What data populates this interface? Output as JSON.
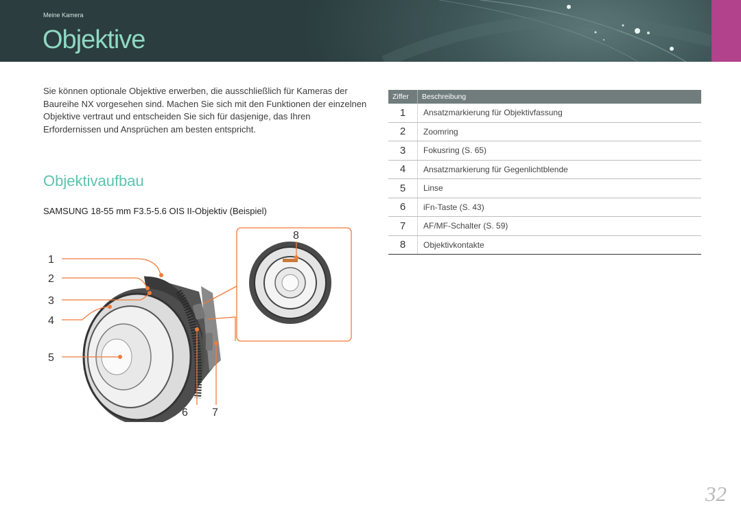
{
  "header": {
    "breadcrumb": "Meine Kamera",
    "title": "Objektive",
    "accent_color": "#b2428c"
  },
  "intro": "Sie können optionale Objektive erwerben, die ausschließlich für Kameras der Baureihe NX vorgesehen sind. Machen Sie sich mit den Funktionen der einzelnen Objektive vertraut und entscheiden Sie sich für dasjenige, das Ihren Erfordernissen und Ansprüchen am besten entspricht.",
  "section": {
    "title": "Objektivaufbau",
    "subtitle": "SAMSUNG 18-55 mm F3.5-5.6 OIS II-Objektiv (Beispiel)"
  },
  "figure": {
    "callouts": [
      "1",
      "2",
      "3",
      "4",
      "5",
      "6",
      "7",
      "8"
    ]
  },
  "table": {
    "headers": [
      "Ziffer",
      "Beschreibung"
    ],
    "rows": [
      {
        "num": "1",
        "desc": "Ansatzmarkierung für Objektivfassung"
      },
      {
        "num": "2",
        "desc": "Zoomring"
      },
      {
        "num": "3",
        "desc": "Fokusring (S. 65)"
      },
      {
        "num": "4",
        "desc": "Ansatzmarkierung für Gegenlichtblende"
      },
      {
        "num": "5",
        "desc": "Linse"
      },
      {
        "num": "6",
        "desc": "iFn-Taste (S. 43)"
      },
      {
        "num": "7",
        "desc": "AF/MF-Schalter (S. 59)"
      },
      {
        "num": "8",
        "desc": "Objektivkontakte"
      }
    ]
  },
  "page_number": "32"
}
